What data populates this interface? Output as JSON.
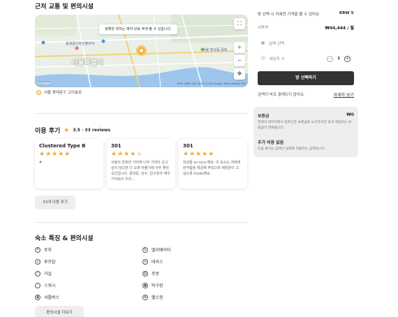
{
  "location": {
    "title": "근처 교통 및 편의시설",
    "map_tip": "정확한 위치는 예약 완료 후에 볼 수 있습니다.",
    "city_label": "서울특별시",
    "labels": [
      "동대문디자인플라자",
      "서울 장사동 중화"
    ],
    "map_credit": "키보드 단축키 지도 데이터 ©2025 Google TMap Mobility 약관",
    "google_text": "Google",
    "address": "서울 동대문구 고이숲로"
  },
  "reviews": {
    "title": "이용 후기",
    "rating": "3.5 · 33 reviews",
    "cards": [
      {
        "name": "Clustered Type B",
        "stars": 5,
        "body": "#"
      },
      {
        "name": "301",
        "stars": 4,
        "body": "서울의 번화한 거리에 너무 가까이 있고 심지 않다면 더 오래 머물기에 아주 좋은 공간입니다. 풍대문, 원수, 업구장과 매우 가까워서 우리..."
      },
      {
        "name": "301",
        "stars": 5,
        "body": "직원들 so nice 해요. 이 숙소는 저에게 만약함을 제공해 주었으며 예방문이 고 싶도록 made해요."
      }
    ],
    "more_button": "33개 이용 후기"
  },
  "amenities": {
    "title": "숙소 특징 & 편의시설",
    "left": [
      "주차",
      "루프탑",
      "거실",
      "스워시",
      "셔틀버스"
    ],
    "right": [
      "엘리베이터",
      "테라스",
      "주방",
      "탁구장",
      "헬스장"
    ],
    "more_button": "편의시설 더보기"
  },
  "booking": {
    "hint": "방 선택 시 자세한 가격을 볼 수 있어요",
    "currency": "KRW",
    "from_label": "시작가",
    "from_price": "₩44,444 / 월",
    "date_placeholder": "날짜 선택",
    "guests_label": "세입자 수",
    "guests_value": "1",
    "cta": "방 선택하기",
    "note": "금액이 바로 결제되지 않아요.",
    "detail_link": "자세히 보기"
  },
  "fees": {
    "deposit_label": "보증금",
    "deposit_value": "₩0",
    "deposit_desc": "현재의 데이터에서 입주인은 보증금을 요구하지만 방과 세입자는 보증금이 면제됩니다.",
    "extra_label": "추가 비용 없음",
    "extra_desc": "지금 보이는 금액이 실제로 지불하는 금액입니다."
  }
}
